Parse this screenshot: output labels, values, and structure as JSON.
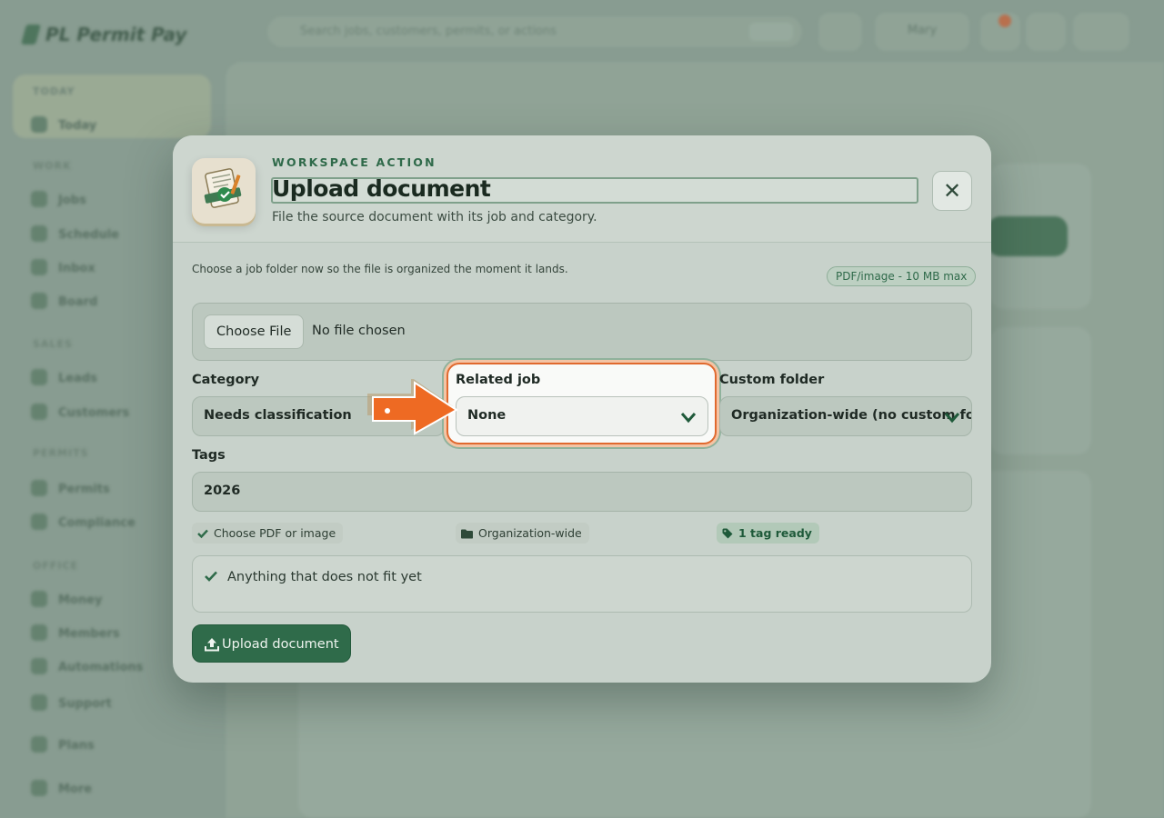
{
  "app": {
    "brand": "PL Permit Pay",
    "search_placeholder": "Search jobs, customers, permits, or actions",
    "user_name": "Mary",
    "sidebar": {
      "sections": [
        {
          "label": "TODAY",
          "items": [
            "Today"
          ]
        },
        {
          "label": "WORK",
          "items": [
            "Jobs",
            "Schedule",
            "Inbox",
            "Board"
          ]
        },
        {
          "label": "SALES",
          "items": [
            "Leads",
            "Customers"
          ]
        },
        {
          "label": "PERMITS",
          "items": [
            "Permits",
            "Compliance"
          ]
        },
        {
          "label": "OFFICE",
          "items": [
            "Money",
            "Members",
            "Automations"
          ]
        },
        {
          "label": "",
          "items": [
            "Support",
            "Plans",
            "More"
          ]
        }
      ]
    }
  },
  "modal": {
    "eyebrow": "WORKSPACE ACTION",
    "title": "Upload document",
    "subtitle": "File the source document with its job and category.",
    "close_icon": "close-icon",
    "hint": "Choose a job folder now so the file is organized the moment it lands.",
    "limit_badge": "PDF/image - 10 MB max",
    "file": {
      "button_label": "Choose File",
      "status": "No file chosen"
    },
    "category": {
      "label": "Category",
      "value": "Needs classification"
    },
    "related_job": {
      "label": "Related job",
      "value": "None"
    },
    "custom_folder": {
      "label": "Custom folder",
      "value": "Organization-wide (no custom folder)"
    },
    "tags": {
      "label": "Tags",
      "value": "2026"
    },
    "status_chips": [
      {
        "icon": "check-icon",
        "text": "Choose PDF or image"
      },
      {
        "icon": "folder-icon",
        "text": "Organization-wide"
      },
      {
        "icon": "tag-icon",
        "text": "1 tag ready"
      }
    ],
    "category_note": "Anything that does not fit yet",
    "submit_label": "Upload document"
  },
  "colors": {
    "accent_green": "#2f6b4a",
    "focus_orange": "#e0692e",
    "modal_bg": "#c8d2cb"
  }
}
